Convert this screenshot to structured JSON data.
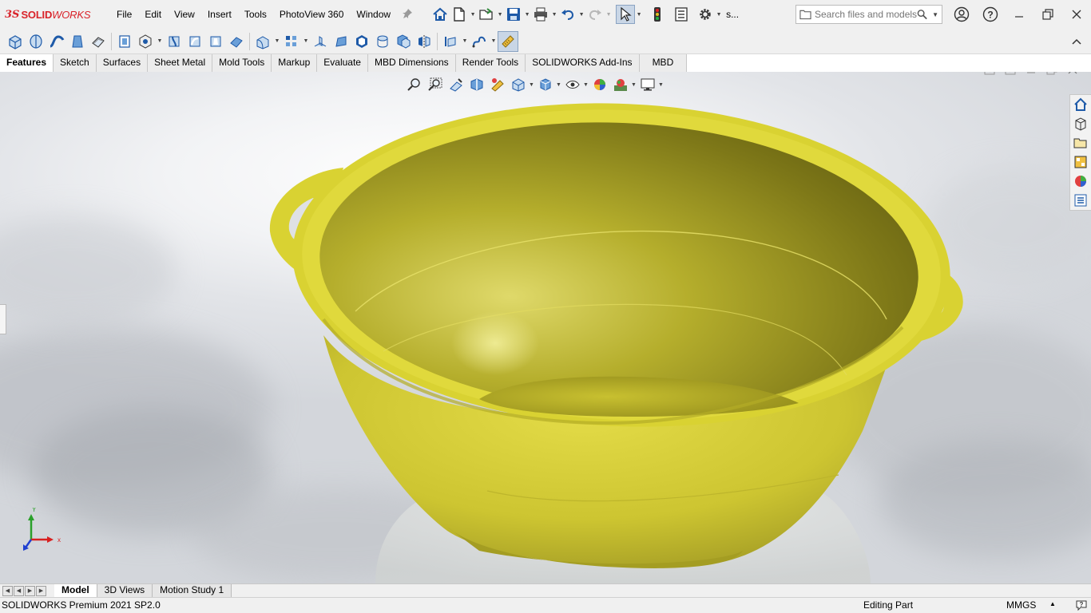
{
  "app": {
    "brand_ds": "3S",
    "brand_solid": "SOLID",
    "brand_works": "WORKS"
  },
  "menu": [
    "File",
    "Edit",
    "View",
    "Insert",
    "Tools",
    "PhotoView 360",
    "Window"
  ],
  "quick_access": {
    "overflow_label": "s..."
  },
  "search": {
    "placeholder": "Search files and models"
  },
  "command_tabs": [
    "Features",
    "Sketch",
    "Surfaces",
    "Sheet Metal",
    "Mold Tools",
    "Markup",
    "Evaluate",
    "MBD Dimensions",
    "Render Tools",
    "SOLIDWORKS Add-Ins",
    "MBD"
  ],
  "active_command_tab": "Features",
  "triad": {
    "x_label": "x",
    "y_label": "Y"
  },
  "bottom_tabs": [
    "Model",
    "3D Views",
    "Motion Study 1"
  ],
  "active_bottom_tab": "Model",
  "status": {
    "product": "SOLIDWORKS Premium 2021 SP2.0",
    "mode": "Editing Part",
    "units": "MMGS"
  },
  "colors": {
    "part": "#d9d33a",
    "part_dark": "#8a8420",
    "brand_red": "#d9232a",
    "toolbar_bg": "#f0f0f0"
  }
}
